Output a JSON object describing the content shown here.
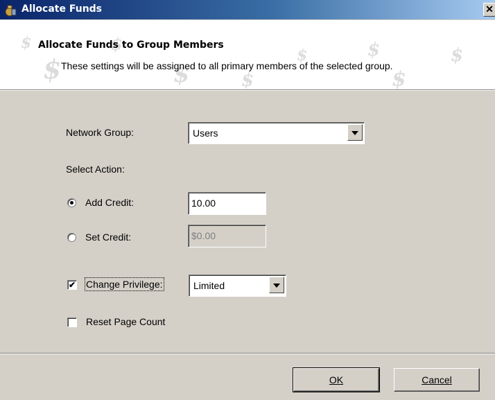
{
  "window": {
    "title": "Allocate Funds",
    "close_glyph": "✕"
  },
  "header": {
    "title": "Allocate Funds to Group Members",
    "subtitle": "These settings will be assigned to all primary members of the selected group.",
    "watermark_glyph": "$"
  },
  "form": {
    "network_group_label": "Network Group:",
    "network_group_value": "Users",
    "select_action_label": "Select Action:",
    "add_credit_label": "Add Credit:",
    "add_credit_value": "10.00",
    "add_credit_selected": true,
    "set_credit_label": "Set Credit:",
    "set_credit_value": "$0.00",
    "set_credit_selected": false,
    "change_privilege_label": "Change Privilege:",
    "change_privilege_checked": true,
    "privilege_value": "Limited",
    "reset_page_count_label": "Reset Page Count",
    "reset_page_count_checked": false,
    "checkmark_glyph": "✔"
  },
  "buttons": {
    "ok_label": "OK",
    "cancel_label": "Cancel"
  },
  "icons": {
    "window_icon": "money-bag-icon",
    "close": "close-icon",
    "dropdown": "chevron-down-icon"
  }
}
